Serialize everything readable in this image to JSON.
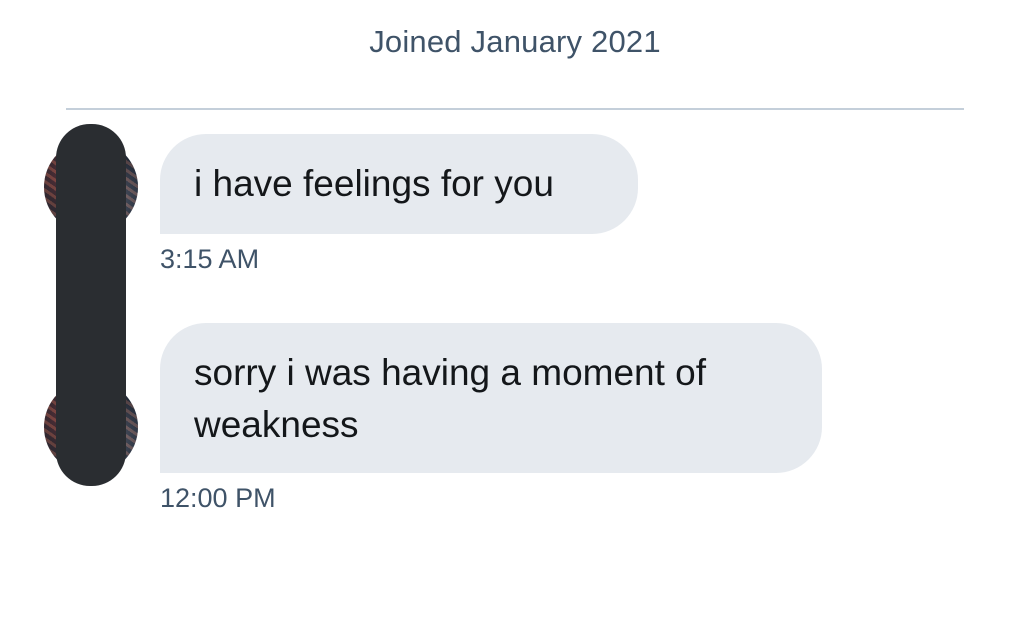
{
  "header": {
    "joined_text": "Joined January 2021"
  },
  "messages": [
    {
      "text": "i have feelings for you",
      "time": "3:15 AM"
    },
    {
      "text": "sorry i was having a moment of weakness",
      "time": "12:00 PM"
    }
  ],
  "colors": {
    "bubble_bg": "#e6eaef",
    "secondary_text": "#3f5368",
    "divider": "#c4cfda",
    "redaction": "#2a2d31"
  }
}
